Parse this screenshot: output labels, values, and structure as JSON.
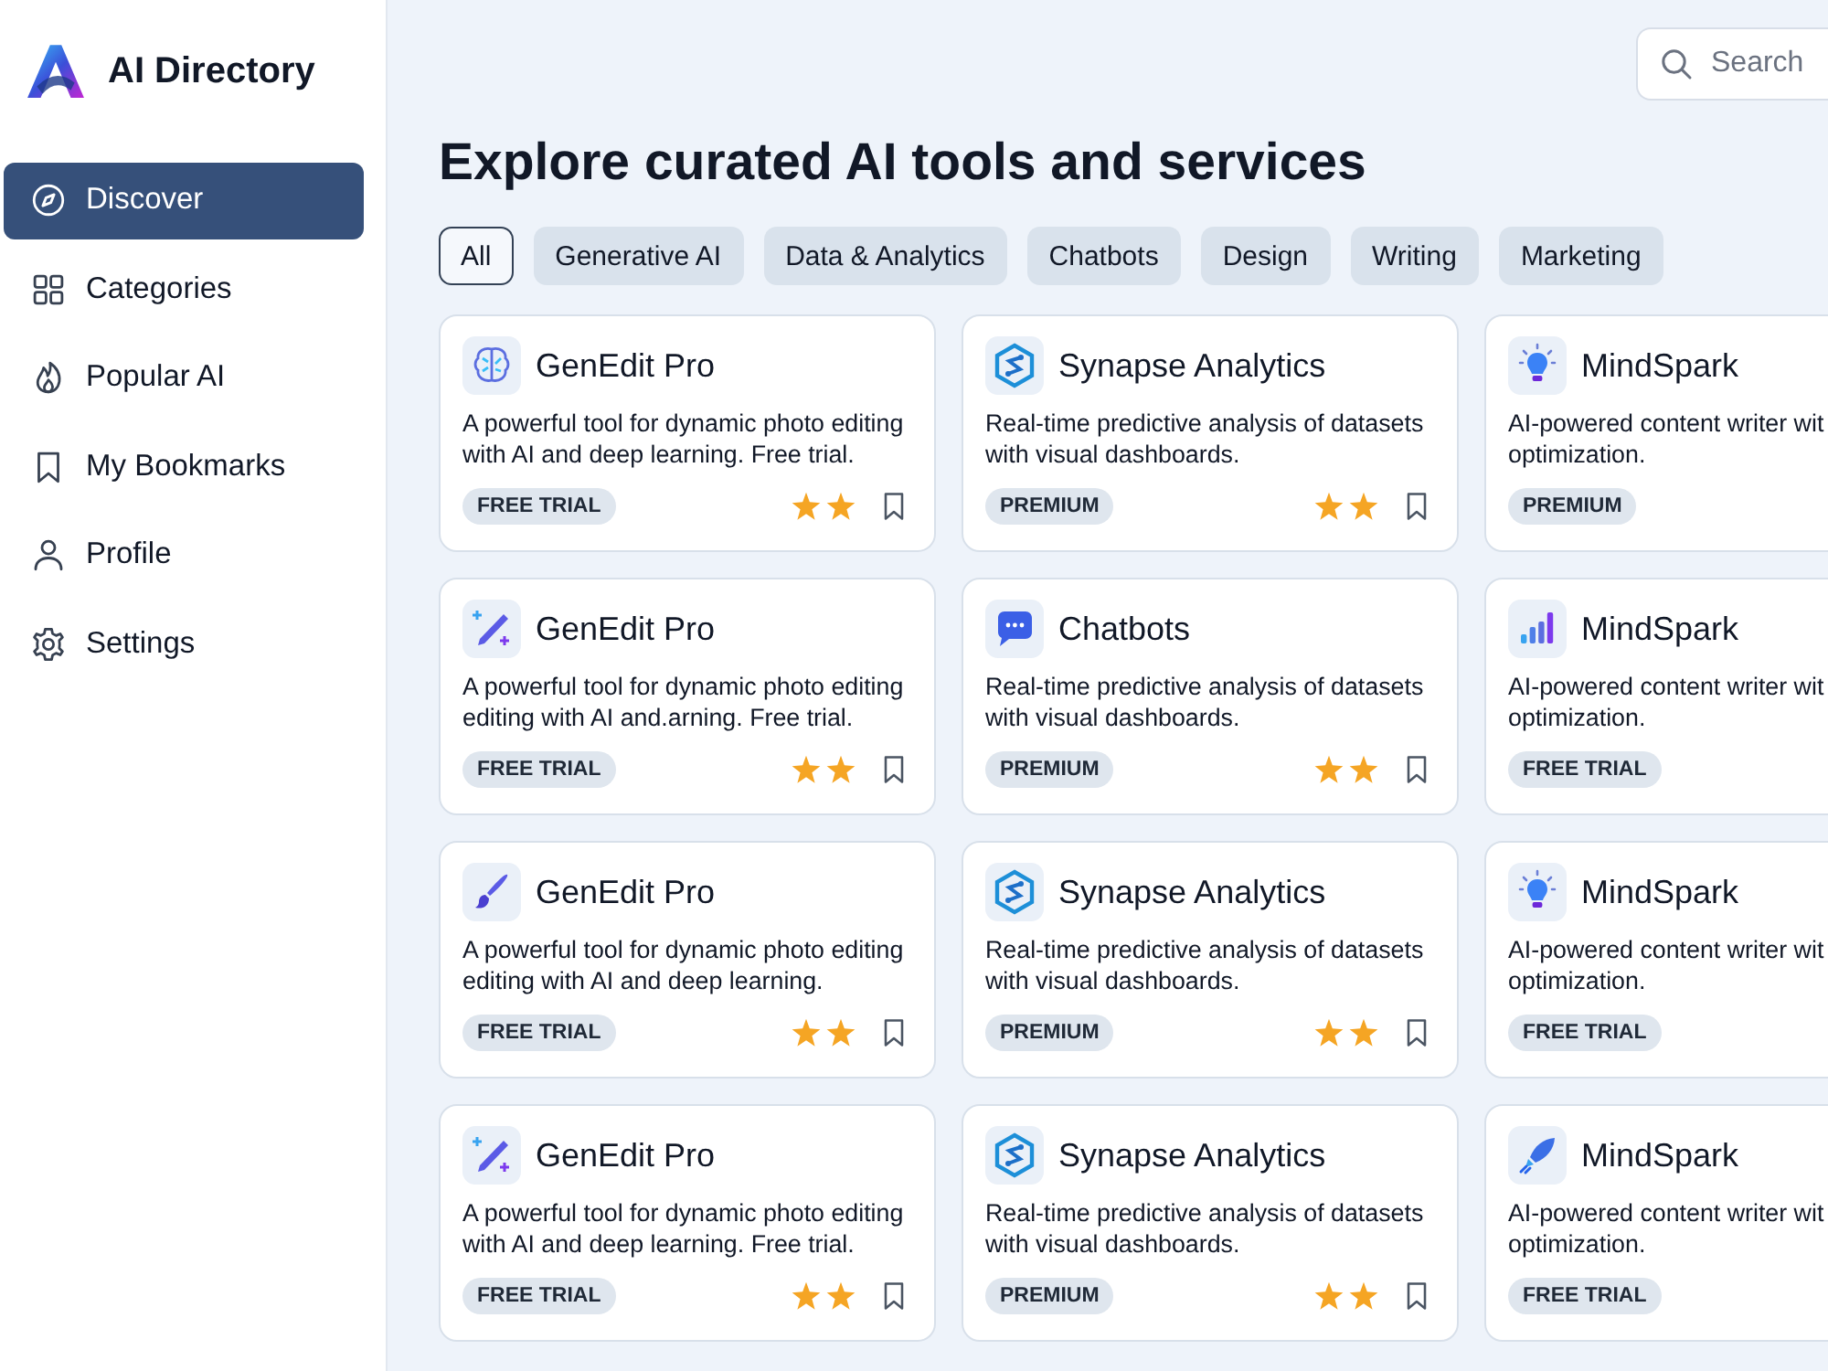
{
  "brand": {
    "name": "AI Directory"
  },
  "nav": [
    {
      "label": "Discover",
      "kind": "compass",
      "selected": true
    },
    {
      "label": "Categories",
      "kind": "grid",
      "selected": false
    },
    {
      "label": "Popular AI",
      "kind": "flame",
      "selected": false
    },
    {
      "label": "My Bookmarks",
      "kind": "bookmark",
      "selected": false
    },
    {
      "label": "Profile",
      "kind": "user",
      "selected": false
    },
    {
      "label": "Settings",
      "kind": "gear",
      "selected": false
    }
  ],
  "search": {
    "placeholder": "Search"
  },
  "heading": "Explore curated AI tools and services",
  "filters": [
    {
      "label": "All",
      "selected": true
    },
    {
      "label": "Generative AI",
      "selected": false
    },
    {
      "label": "Data & Analytics",
      "selected": false
    },
    {
      "label": "Chatbots",
      "selected": false
    },
    {
      "label": "Design",
      "selected": false
    },
    {
      "label": "Writing",
      "selected": false
    },
    {
      "label": "Marketing",
      "selected": false
    }
  ],
  "cards": [
    {
      "name": "GenEdit Pro",
      "kind": "brain",
      "description": [
        "A powerful tool for dynamic photo editing",
        "with AI and deep learning. Free trial."
      ],
      "badge": "FREE TRIAL",
      "bookmarked": false
    },
    {
      "name": "Synapse Analytics",
      "kind": "hexagon",
      "description": [
        "Real-time predictive analysis of datasets",
        "with visual dashboards."
      ],
      "badge": "PREMIUM",
      "bookmarked": false
    },
    {
      "name": "MindSpark",
      "kind": "bulb",
      "description": [
        "AI-powered content writer wit",
        "optimization."
      ],
      "badge": "PREMIUM"
    },
    {
      "name": "GenEdit Pro",
      "kind": "wand",
      "description": [
        "A powerful tool for dynamic photo editing",
        "editing with AI and.arning. Free trial."
      ],
      "badge": "FREE TRIAL",
      "bookmarked": false
    },
    {
      "name": "Chatbots",
      "kind": "chat",
      "description": [
        "Real-time predictive analysis of datasets",
        "with visual dashboards."
      ],
      "badge": "PREMIUM",
      "bookmarked": false
    },
    {
      "name": "MindSpark",
      "kind": "bars",
      "description": [
        "AI-powered content writer wit",
        "optimization."
      ],
      "badge": "FREE TRIAL"
    },
    {
      "name": "GenEdit Pro",
      "kind": "brush",
      "description": [
        "A powerful tool for dynamic photo editing",
        "editing with AI and deep learning."
      ],
      "badge": "FREE TRIAL",
      "bookmarked": false
    },
    {
      "name": "Synapse Analytics",
      "kind": "hexagon",
      "description": [
        "Real-time predictive analysis of datasets",
        "with visual dashboards."
      ],
      "badge": "PREMIUM",
      "bookmarked": false
    },
    {
      "name": "MindSpark",
      "kind": "bulb",
      "description": [
        "AI-powered content writer wit",
        "optimization."
      ],
      "badge": "FREE TRIAL"
    },
    {
      "name": "GenEdit Pro",
      "kind": "wand",
      "description": [
        "A powerful tool for dynamic photo editing",
        "with AI and deep learning. Free trial."
      ],
      "badge": "FREE TRIAL",
      "bookmarked": false
    },
    {
      "name": "Synapse Analytics",
      "kind": "hexagon",
      "description": [
        "Real-time predictive analysis of datasets",
        "with visual dashboards."
      ],
      "badge": "PREMIUM",
      "bookmarked": false
    },
    {
      "name": "MindSpark",
      "kind": "rocket",
      "description": [
        "AI-powered content writer wit",
        "optimization."
      ],
      "badge": "FREE TRIAL"
    }
  ]
}
